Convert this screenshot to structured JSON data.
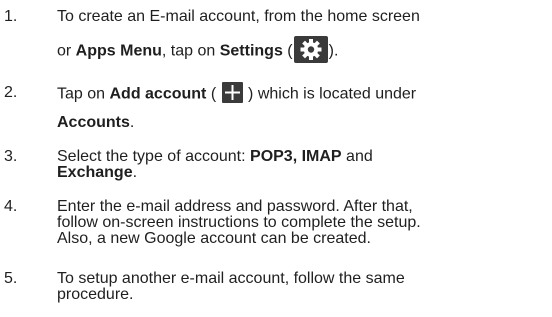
{
  "steps": [
    {
      "number": "1.",
      "line1": "To create an E-mail account, from the home screen",
      "line2_pre": "or ",
      "line2_bold1": "Apps Menu",
      "line2_mid": ", tap on ",
      "line2_bold2": "Settings",
      "line2_open": " (",
      "line2_close": ").",
      "icon": "settings-gear-icon"
    },
    {
      "number": "2.",
      "line1_pre": "Tap on ",
      "line1_bold": "Add account",
      "line1_open": " ( ",
      "line1_post": " ) which is located under",
      "line2_bold": "Accounts",
      "line2_post": ".",
      "icon": "plus-icon"
    },
    {
      "number": "3.",
      "line1_pre": "Select the type of account: ",
      "line1_bold": "POP3, IMAP",
      "line1_post": " and",
      "line2_bold": "Exchange",
      "line2_post": "."
    },
    {
      "number": "4.",
      "line1": "Enter the e-mail address and password. After that,",
      "line2": "follow on-screen instructions to complete the setup.",
      "line3": "Also, a new Google account can be created."
    },
    {
      "number": "5.",
      "line1": "To setup another e-mail account, follow the same",
      "line2": "procedure."
    }
  ],
  "colors": {
    "text": "#1f1f1f",
    "icon_bg": "#3a3a3a",
    "icon_fg": "#ffffff"
  }
}
